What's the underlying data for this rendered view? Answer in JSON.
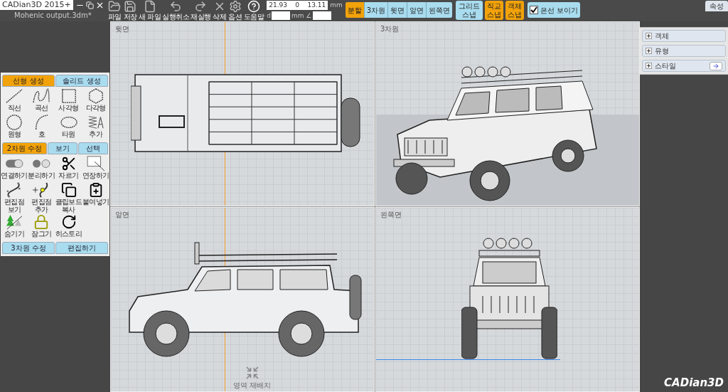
{
  "app": {
    "title": "CADian3D 2015+",
    "file": "Mohenic output.3dm*"
  },
  "toolbar": [
    {
      "label": "파일"
    },
    {
      "label": "저장"
    },
    {
      "label": "새 파일"
    },
    {
      "label": "실행취소"
    },
    {
      "label": "재실행"
    },
    {
      "label": "삭제"
    },
    {
      "label": "옵션"
    },
    {
      "label": "도움말"
    }
  ],
  "coords": {
    "values": [
      "21.93",
      "0",
      "13.11"
    ],
    "unit": "mm",
    "distance_label": "d",
    "angle_label": "mm ∠"
  },
  "view_tabs": [
    {
      "label": "분할",
      "selected": true
    },
    {
      "label": "3차원",
      "selected": false
    },
    {
      "label": "윗면",
      "selected": false
    },
    {
      "label": "앞면",
      "selected": false
    },
    {
      "label": "왼쪽면",
      "selected": false
    }
  ],
  "snaps": [
    {
      "label": "그리드 스냅",
      "on": false
    },
    {
      "label": "직교 스냅",
      "on": true
    },
    {
      "label": "객체 스냅",
      "on": true
    }
  ],
  "hidden_lines": {
    "label": "은선 보이기",
    "checked": true
  },
  "properties_tab": "속성",
  "left_panel": {
    "sections": [
      {
        "tabs": [
          {
            "label": "선형 생성",
            "selected": true
          },
          {
            "label": "솔리드 생성",
            "selected": false
          }
        ],
        "tools": [
          {
            "label": "직선"
          },
          {
            "label": "곡선"
          },
          {
            "label": "사각형"
          },
          {
            "label": "다각형"
          },
          {
            "label": "원형"
          },
          {
            "label": "호"
          },
          {
            "label": "타원"
          },
          {
            "label": "추가"
          }
        ]
      },
      {
        "tabs": [
          {
            "label": "2차원 수정",
            "selected": true
          },
          {
            "label": "보기",
            "selected": false
          },
          {
            "label": "선택",
            "selected": false
          }
        ],
        "tools": [
          {
            "label": "연결하기"
          },
          {
            "label": "분리하기"
          },
          {
            "label": "자르기"
          },
          {
            "label": "연장하기"
          },
          {
            "label": "편집점 보기"
          },
          {
            "label": "편집점 추가"
          },
          {
            "label": "클립보드 복사"
          },
          {
            "label": "붙여넣기"
          },
          {
            "label": "숨기기"
          },
          {
            "label": "잠그기"
          },
          {
            "label": "히스토리"
          }
        ]
      }
    ],
    "bottom_tabs": [
      {
        "label": "3차원 수정",
        "selected": false
      },
      {
        "label": "편집하기",
        "selected": false
      }
    ]
  },
  "viewports": [
    {
      "label": "윗면"
    },
    {
      "label": "3차원"
    },
    {
      "label": "앞면"
    },
    {
      "label": "왼쪽면"
    }
  ],
  "relayout": "영역 재배치",
  "right_panel": {
    "items": [
      {
        "label": "객체",
        "expanded": false,
        "kind": "plain"
      },
      {
        "label": "유형",
        "expanded": false,
        "kind": "plain"
      },
      {
        "label": "스타일",
        "expanded": false,
        "kind": "link"
      }
    ]
  },
  "logo": "CADian3D"
}
